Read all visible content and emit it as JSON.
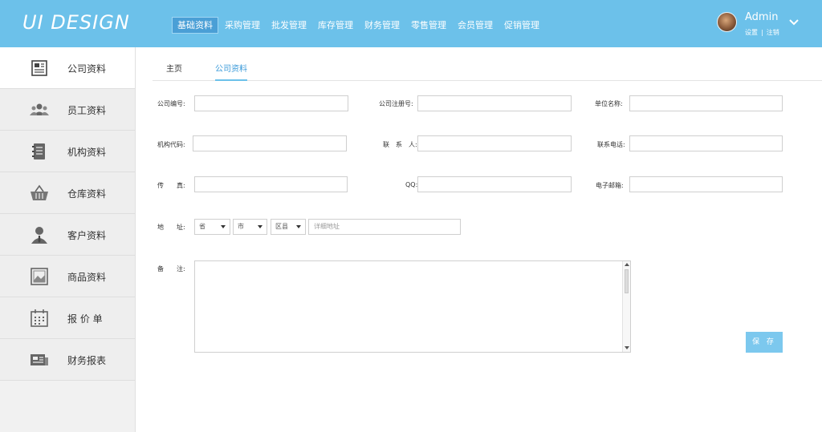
{
  "header": {
    "logo": "UI DESIGN",
    "nav": [
      "基础资料",
      "采购管理",
      "批发管理",
      "库存管理",
      "财务管理",
      "零售管理",
      "会员管理",
      "促销管理"
    ],
    "user_name": "Admin",
    "settings_link": "设置",
    "separator": "|",
    "logout_link": "注销"
  },
  "sidebar": {
    "items": [
      {
        "label": "公司资料",
        "icon": "newspaper-icon"
      },
      {
        "label": "员工资料",
        "icon": "users-icon"
      },
      {
        "label": "机构资料",
        "icon": "notebook-icon"
      },
      {
        "label": "仓库资料",
        "icon": "basket-icon"
      },
      {
        "label": "客户资料",
        "icon": "customer-icon"
      },
      {
        "label": "商品资料",
        "icon": "image-icon"
      },
      {
        "label": "报 价 单",
        "icon": "calendar-icon"
      },
      {
        "label": "财务报表",
        "icon": "report-icon"
      }
    ]
  },
  "tabs": [
    "主页",
    "公司资料"
  ],
  "form": {
    "company_no": "公司编号:",
    "company_reg": "公司注册号:",
    "unit_name": "单位名称:",
    "org_code": "机构代码:",
    "contact": "联　系　人:",
    "contact_phone": "联系电话:",
    "fax": "传　　真:",
    "qq": "QQ:",
    "email": "电子邮箱:",
    "address": "地　　址:",
    "province": "省",
    "city": "市",
    "district": "区县",
    "address_placeholder": "详细地址",
    "remark": "备　　注:",
    "save": "保 存"
  },
  "colors": {
    "header_bg": "#6cc1ea",
    "accent": "#3a9ad9",
    "button": "#7cc8ee"
  }
}
